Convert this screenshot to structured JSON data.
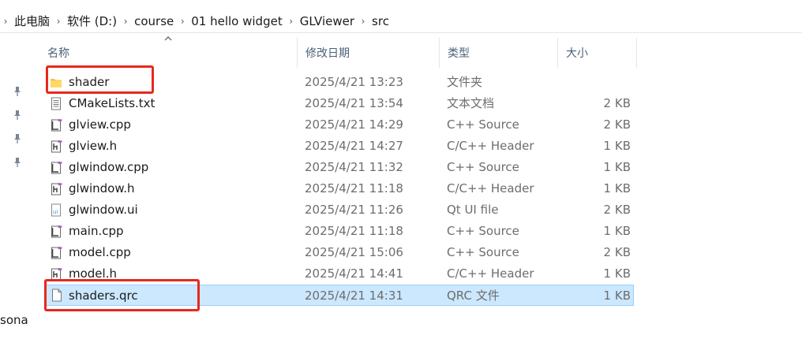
{
  "breadcrumb": {
    "items": [
      "此电脑",
      "软件 (D:)",
      "course",
      "01 hello widget",
      "GLViewer",
      "src"
    ]
  },
  "columns": {
    "name": "名称",
    "date": "修改日期",
    "type": "类型",
    "size": "大小"
  },
  "files": [
    {
      "name": "shader",
      "date": "2025/4/21 13:23",
      "type": "文件夹",
      "size": "",
      "icon": "folder-icon"
    },
    {
      "name": "CMakeLists.txt",
      "date": "2025/4/21 13:54",
      "type": "文本文档",
      "size": "2 KB",
      "icon": "text-file-icon"
    },
    {
      "name": "glview.cpp",
      "date": "2025/4/21 14:29",
      "type": "C++ Source",
      "size": "2 KB",
      "icon": "cpp-file-icon"
    },
    {
      "name": "glview.h",
      "date": "2025/4/21 14:27",
      "type": "C/C++ Header",
      "size": "1 KB",
      "icon": "header-file-icon"
    },
    {
      "name": "glwindow.cpp",
      "date": "2025/4/21 11:32",
      "type": "C++ Source",
      "size": "1 KB",
      "icon": "cpp-file-icon"
    },
    {
      "name": "glwindow.h",
      "date": "2025/4/21 11:18",
      "type": "C/C++ Header",
      "size": "1 KB",
      "icon": "header-file-icon"
    },
    {
      "name": "glwindow.ui",
      "date": "2025/4/21 11:26",
      "type": "Qt UI file",
      "size": "2 KB",
      "icon": "ui-file-icon"
    },
    {
      "name": "main.cpp",
      "date": "2025/4/21 11:18",
      "type": "C++ Source",
      "size": "1 KB",
      "icon": "cpp-file-icon"
    },
    {
      "name": "model.cpp",
      "date": "2025/4/21 15:06",
      "type": "C++ Source",
      "size": "2 KB",
      "icon": "cpp-file-icon"
    },
    {
      "name": "model.h",
      "date": "2025/4/21 14:41",
      "type": "C/C++ Header",
      "size": "1 KB",
      "icon": "header-file-icon"
    },
    {
      "name": "shaders.qrc",
      "date": "2025/4/21 14:31",
      "type": "QRC 文件",
      "size": "1 KB",
      "icon": "blank-file-icon"
    }
  ],
  "left_pane": {
    "partial_text": "sona"
  },
  "colors": {
    "selection": "#cce8ff",
    "annotation_red": "#e8281e",
    "folder": "#f3c54a"
  }
}
